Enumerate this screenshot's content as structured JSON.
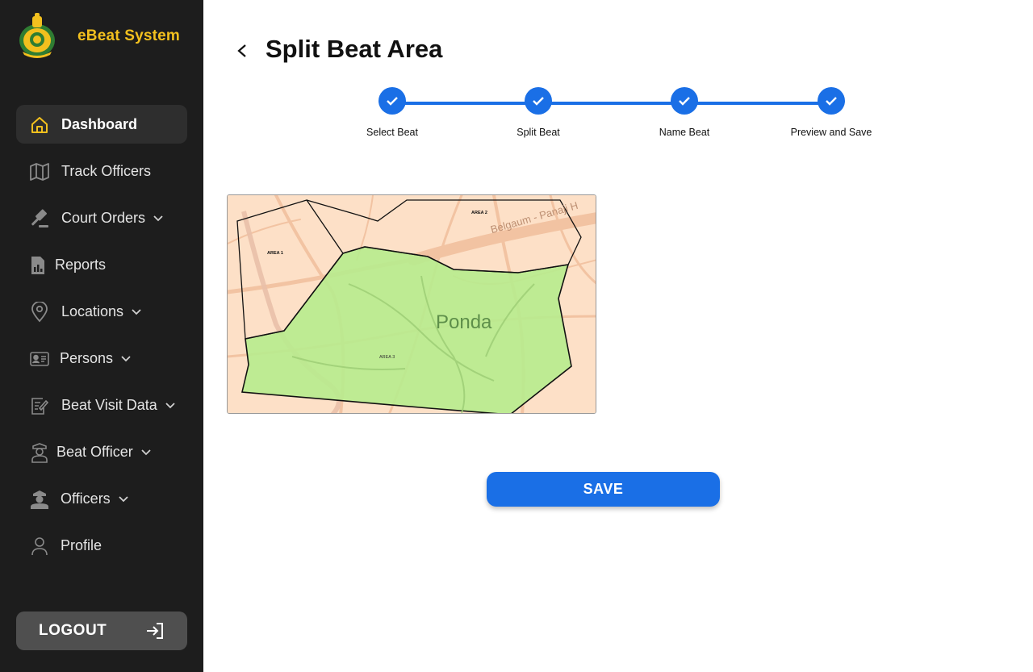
{
  "app": {
    "title": "eBeat System"
  },
  "sidebar": {
    "items": [
      {
        "label": "Dashboard",
        "icon": "home-icon",
        "active": true,
        "has_submenu": false
      },
      {
        "label": "Track Officers",
        "icon": "map-icon",
        "has_submenu": false
      },
      {
        "label": "Court Orders",
        "icon": "gavel-icon",
        "has_submenu": true
      },
      {
        "label": "Reports",
        "icon": "report-icon",
        "has_submenu": false
      },
      {
        "label": "Locations",
        "icon": "location-pin-icon",
        "has_submenu": true
      },
      {
        "label": "Persons",
        "icon": "id-card-icon",
        "has_submenu": true
      },
      {
        "label": "Beat Visit Data",
        "icon": "clipboard-edit-icon",
        "has_submenu": true
      },
      {
        "label": "Beat Officer",
        "icon": "officer-icon",
        "has_submenu": true
      },
      {
        "label": "Officers",
        "icon": "police-icon",
        "has_submenu": true
      },
      {
        "label": "Profile",
        "icon": "user-icon",
        "has_submenu": false
      }
    ],
    "logout_label": "LOGOUT"
  },
  "page": {
    "title": "Split Beat Area"
  },
  "stepper": {
    "steps": [
      {
        "label": "Select Beat",
        "done": true
      },
      {
        "label": "Split Beat",
        "done": true
      },
      {
        "label": "Name Beat",
        "done": true
      },
      {
        "label": "Preview and Save",
        "done": true
      }
    ]
  },
  "map": {
    "town_label": "Ponda",
    "road_label": "Belgaum - Panaji H",
    "areas": [
      "AREA 1",
      "AREA 2",
      "AREA 3"
    ]
  },
  "actions": {
    "save_label": "SAVE"
  },
  "colors": {
    "accent": "#1a6fe6",
    "brand": "#f2c01e",
    "sidebar_bg": "#1d1d1d",
    "area_fill": "#b9eb8e"
  }
}
